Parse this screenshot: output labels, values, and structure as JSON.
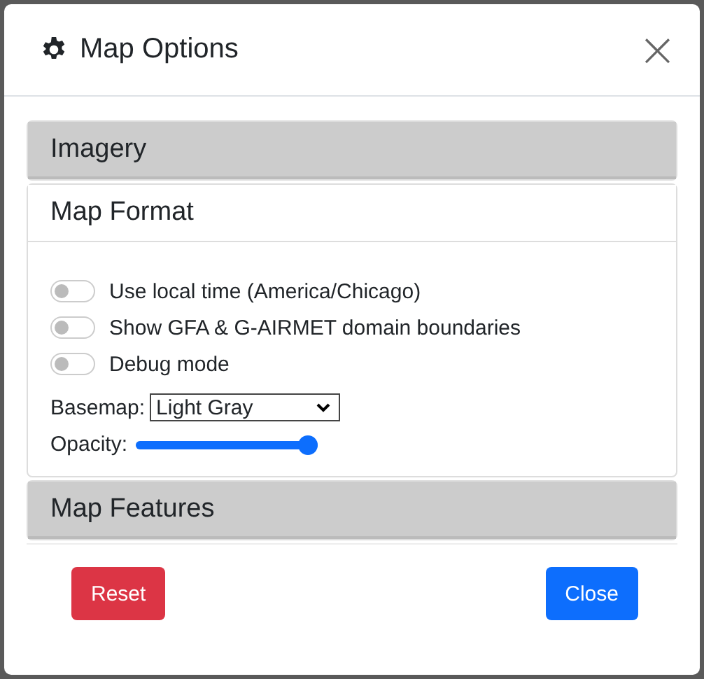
{
  "window": {
    "title": "Map Options",
    "close": "×"
  },
  "sections": [
    {
      "title": "Imagery",
      "expanded": false
    },
    {
      "title": "Map Format",
      "expanded": true,
      "toggles": [
        {
          "label": "Use local time (America/Chicago)",
          "on": false
        },
        {
          "label": "Show GFA & G-AIRMET domain boundaries",
          "on": false
        },
        {
          "label": "Debug mode",
          "on": false
        }
      ],
      "basemap": {
        "label": "Basemap:",
        "value": "Light Gray"
      },
      "opacity": {
        "label": "Opacity:",
        "level": 1
      }
    },
    {
      "title": "Map Features",
      "expanded": false
    }
  ],
  "buttons": [
    {
      "label": "Reset",
      "kind": "danger"
    },
    {
      "label": "Close",
      "kind": "primary"
    }
  ]
}
